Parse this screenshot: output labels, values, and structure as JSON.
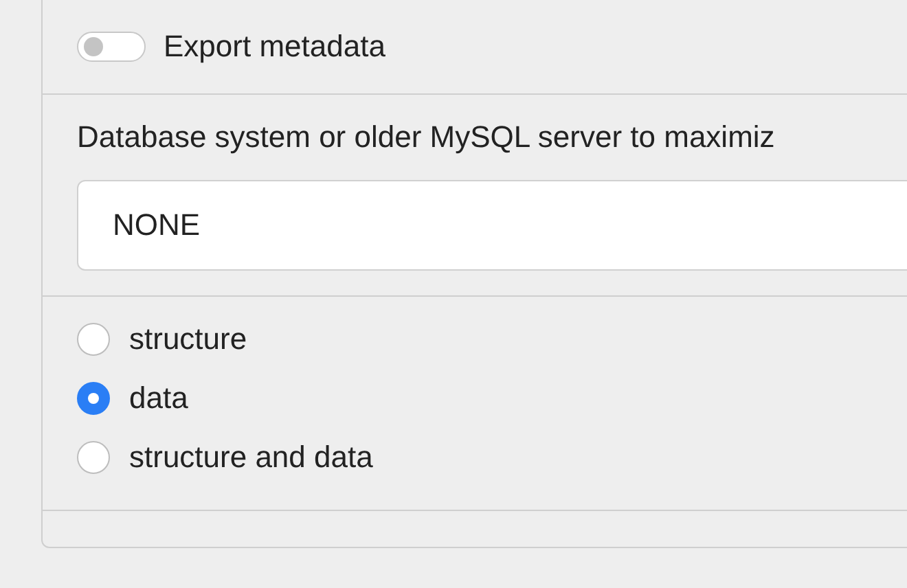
{
  "export_metadata": {
    "label": "Export metadata",
    "on": false
  },
  "compatibility": {
    "label": "Database system or older MySQL server to maximiz",
    "value": "NONE"
  },
  "dump_options": [
    {
      "label": "structure",
      "selected": false
    },
    {
      "label": "data",
      "selected": true
    },
    {
      "label": "structure and data",
      "selected": false
    }
  ]
}
